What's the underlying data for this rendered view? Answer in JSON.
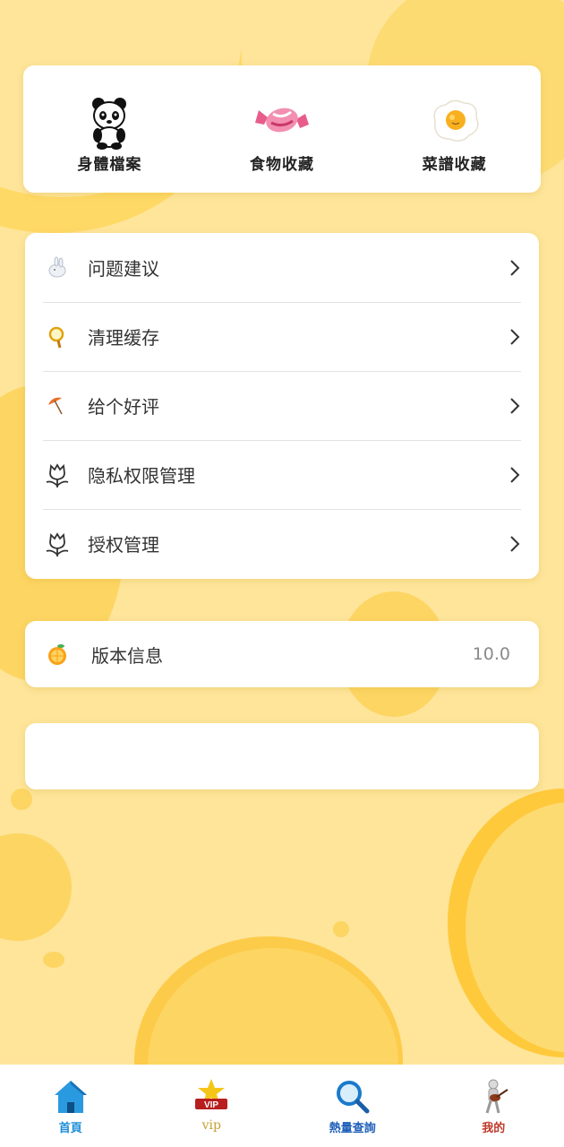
{
  "quick_actions": [
    {
      "label": "身體檔案",
      "icon": "panda-icon"
    },
    {
      "label": "食物收藏",
      "icon": "candy-icon"
    },
    {
      "label": "菜譜收藏",
      "icon": "fried-egg-icon"
    }
  ],
  "menu": {
    "items": [
      {
        "label": "问题建议",
        "icon": "rabbit-icon"
      },
      {
        "label": "清理缓存",
        "icon": "magnifier-icon"
      },
      {
        "label": "给个好评",
        "icon": "umbrella-icon"
      },
      {
        "label": "隐私权限管理",
        "icon": "tulip-icon"
      },
      {
        "label": "授权管理",
        "icon": "tulip-icon"
      }
    ]
  },
  "version": {
    "label": "版本信息",
    "value": "10.0",
    "icon": "orange-icon"
  },
  "tabbar": {
    "tabs": [
      {
        "label": "首頁",
        "icon": "home-icon",
        "color": "#1E8ED8"
      },
      {
        "label": "vip",
        "icon": "vip-crown-icon",
        "color": "#C8A030"
      },
      {
        "label": "熱量查詢",
        "icon": "search-icon",
        "color": "#1E5FB8"
      },
      {
        "label": "我的",
        "icon": "guitarist-icon",
        "color": "#C0392B"
      }
    ]
  },
  "colors": {
    "background": "#FEE59A",
    "accent": "#FDD563",
    "card": "#FFFFFF"
  }
}
